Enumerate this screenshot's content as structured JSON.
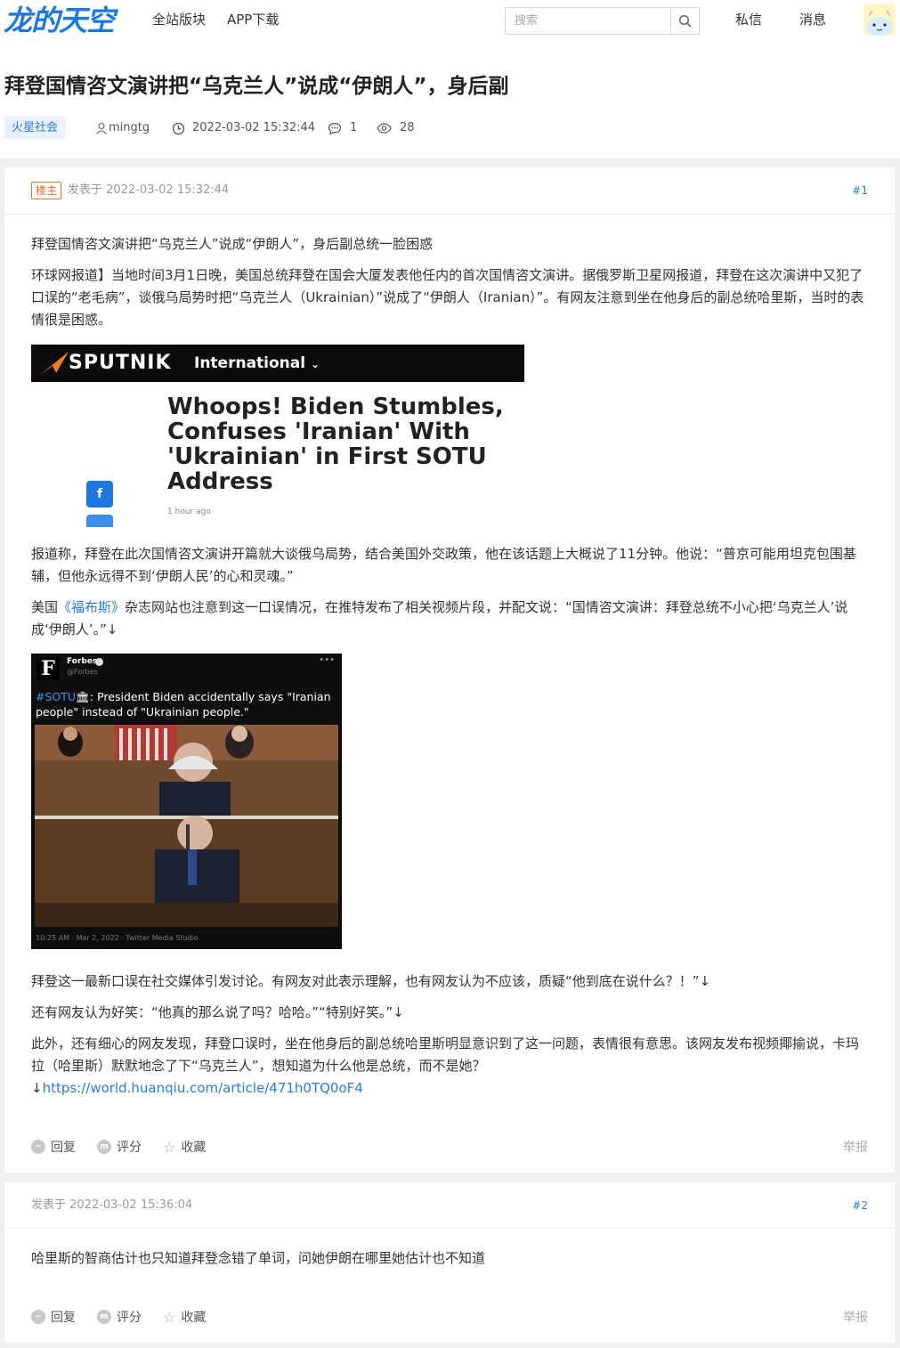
{
  "header": {
    "logo": "龙的天空",
    "nav": [
      "全站版块",
      "APP下载"
    ],
    "search_placeholder": "搜索",
    "links": [
      "私信",
      "消息"
    ]
  },
  "thread": {
    "title": "拜登国情咨文演讲把“乌克兰人”说成“伊朗人”，身后副",
    "tag": "火星社会",
    "author": "mingtg",
    "datetime": "2022-03-02 15:32:44",
    "replies": "1",
    "views": "28"
  },
  "posts": [
    {
      "badge": "楼主",
      "posted": "发表于 2022-03-02 15:32:44",
      "floor": "#1",
      "paragraphs": [
        "拜登国情咨文演讲把“乌克兰人”说成“伊朗人”，身后副总统一脸困惑",
        "环球网报道】当地时间3月1日晚，美国总统拜登在国会大厦发表他任内的首次国情咨文演讲。据俄罗斯卫星网报道，拜登在这次演讲中又犯了口误的“老毛病”，谈俄乌局势时把“乌克兰人（Ukrainian）”说成了“伊朗人（Iranian）”。有网友注意到坐在他身后的副总统哈里斯，当时的表情很是困惑。",
        "报道称，拜登在此次国情咨文演讲开篇就大谈俄乌局势，结合美国外交政策，他在该话题上大概说了11分钟。他说：“普京可能用坦克包围基辅，但他永远得不到‘伊朗人民’的心和灵魂。”",
        "拜登这一最新口误在社交媒体引发讨论。有网友对此表示理解，也有网友认为不应该，质疑“他到底在说什么？！”↓",
        "还有网友认为好笑：“他真的那么说了吗？哈哈。”“特别好笑。”↓",
        "此外，还有细心的网友发现，拜登口误时，坐在他身后的副总统哈里斯明显意识到了这一问题，表情很有意思。该网友发布视频揶揄说，卡玛拉（哈里斯）默默地念了下“乌克兰人”，想知道为什么他是总统，而不是她？"
      ],
      "forbes_para": {
        "before": "美国",
        "link": "《福布斯》",
        "after": "杂志网站也注意到这一口误情况，在推特发布了相关视频片段，并配文说：“国情咨文演讲：拜登总统不小心把‘乌克兰人’说成‘伊朗人’。”↓"
      },
      "source_arrow": "↓",
      "source_link": "https://world.huanqiu.com/article/471h0TQ0oF4",
      "sputnik": {
        "logo": "SPUTNIK",
        "edition": "International",
        "headline": "Whoops! Biden Stumbles, Confuses 'Iranian' With 'Ukrainian' in First SOTU Address",
        "time": "1 hour ago"
      },
      "tweet": {
        "name": "Forbes",
        "handle": "@Forbes",
        "hashtag": "#SOTU",
        "text": ": President Biden accidentally says \"Iranian people\" instead of \"Ukrainian people.\"",
        "footer": "10:25 AM · Mar 2, 2022 · Twitter Media Studio"
      }
    },
    {
      "posted": "发表于 2022-03-02 15:36:04",
      "floor": "#2",
      "text": "哈里斯的智商估计也只知道拜登念错了单词，问她伊朗在哪里她估计也不知道"
    }
  ],
  "actions": {
    "reply": "回复",
    "rate": "评分",
    "favorite": "收藏",
    "report": "举报"
  },
  "colors": {
    "logo": "#1a78e0",
    "link": "#2b7be0",
    "badge": "#e8702a",
    "page_bg": "#f0f0f2"
  }
}
